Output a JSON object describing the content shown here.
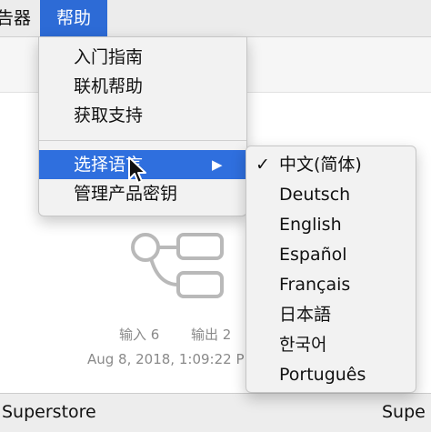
{
  "menubar": {
    "partial_item": "告器",
    "help_label": "帮助"
  },
  "help_menu": {
    "items": [
      {
        "label": "入门指南"
      },
      {
        "label": "联机帮助"
      },
      {
        "label": "获取支持"
      },
      {
        "label": "选择语言",
        "highlighted": true,
        "submenu_arrow": "▶"
      },
      {
        "label": "管理产品密钥"
      }
    ]
  },
  "language_menu": {
    "check_mark": "✓",
    "selected": "中文(简体)",
    "items": [
      {
        "label": "中文(简体)",
        "checked": true
      },
      {
        "label": "Deutsch"
      },
      {
        "label": "English"
      },
      {
        "label": "Español"
      },
      {
        "label": "Français"
      },
      {
        "label": "日本語"
      },
      {
        "label": "한국어"
      },
      {
        "label": "Português"
      }
    ]
  },
  "flow_card": {
    "inputs_label": "输入 6",
    "outputs_label": "输出 2",
    "date": "Aug 8, 2018, 1:09:22 P"
  },
  "footer": {
    "left_label": "Superstore",
    "right_label": "Supe"
  },
  "colors": {
    "highlight": "#2f6fde",
    "menubar_active": "#2d6bd6",
    "menu_background": "#f2f2f2"
  }
}
